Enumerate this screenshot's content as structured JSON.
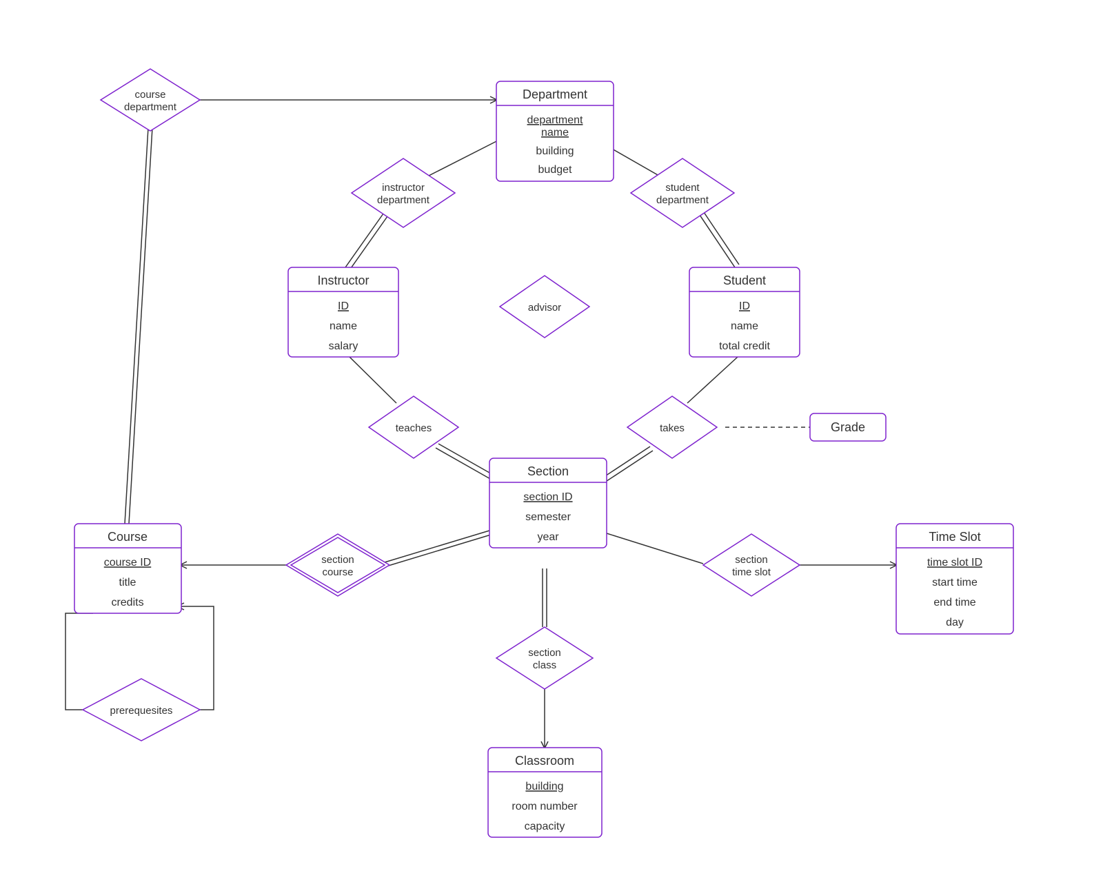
{
  "entities": {
    "department": {
      "title": "Department",
      "key": "department name",
      "attrs": [
        "building",
        "budget"
      ]
    },
    "instructor": {
      "title": "Instructor",
      "key": "ID",
      "attrs": [
        "name",
        "salary"
      ]
    },
    "student": {
      "title": "Student",
      "key": "ID",
      "attrs": [
        "name",
        "total credit"
      ]
    },
    "section": {
      "title": "Section",
      "key": "section ID",
      "attrs": [
        "semester",
        "year"
      ]
    },
    "course": {
      "title": "Course",
      "key": "course ID",
      "attrs": [
        "title",
        "credits"
      ]
    },
    "classroom": {
      "title": "Classroom",
      "key": "building",
      "attrs": [
        "room number",
        "capacity"
      ]
    },
    "timeslot": {
      "title": "Time Slot",
      "key": "time slot ID",
      "attrs": [
        "start time",
        "end time",
        "day"
      ]
    },
    "grade": {
      "title": "Grade"
    }
  },
  "relationships": {
    "course_department": {
      "line1": "course",
      "line2": "department"
    },
    "instructor_department": {
      "line1": "instructor",
      "line2": "department"
    },
    "student_department": {
      "line1": "student",
      "line2": "department"
    },
    "advisor": {
      "line1": "advisor"
    },
    "teaches": {
      "line1": "teaches"
    },
    "takes": {
      "line1": "takes"
    },
    "section_course": {
      "line1": "section",
      "line2": "course"
    },
    "section_class": {
      "line1": "section",
      "line2": "class"
    },
    "section_timeslot": {
      "line1": "section",
      "line2": "time slot"
    },
    "prerequisites": {
      "line1": "prerequesites"
    }
  }
}
